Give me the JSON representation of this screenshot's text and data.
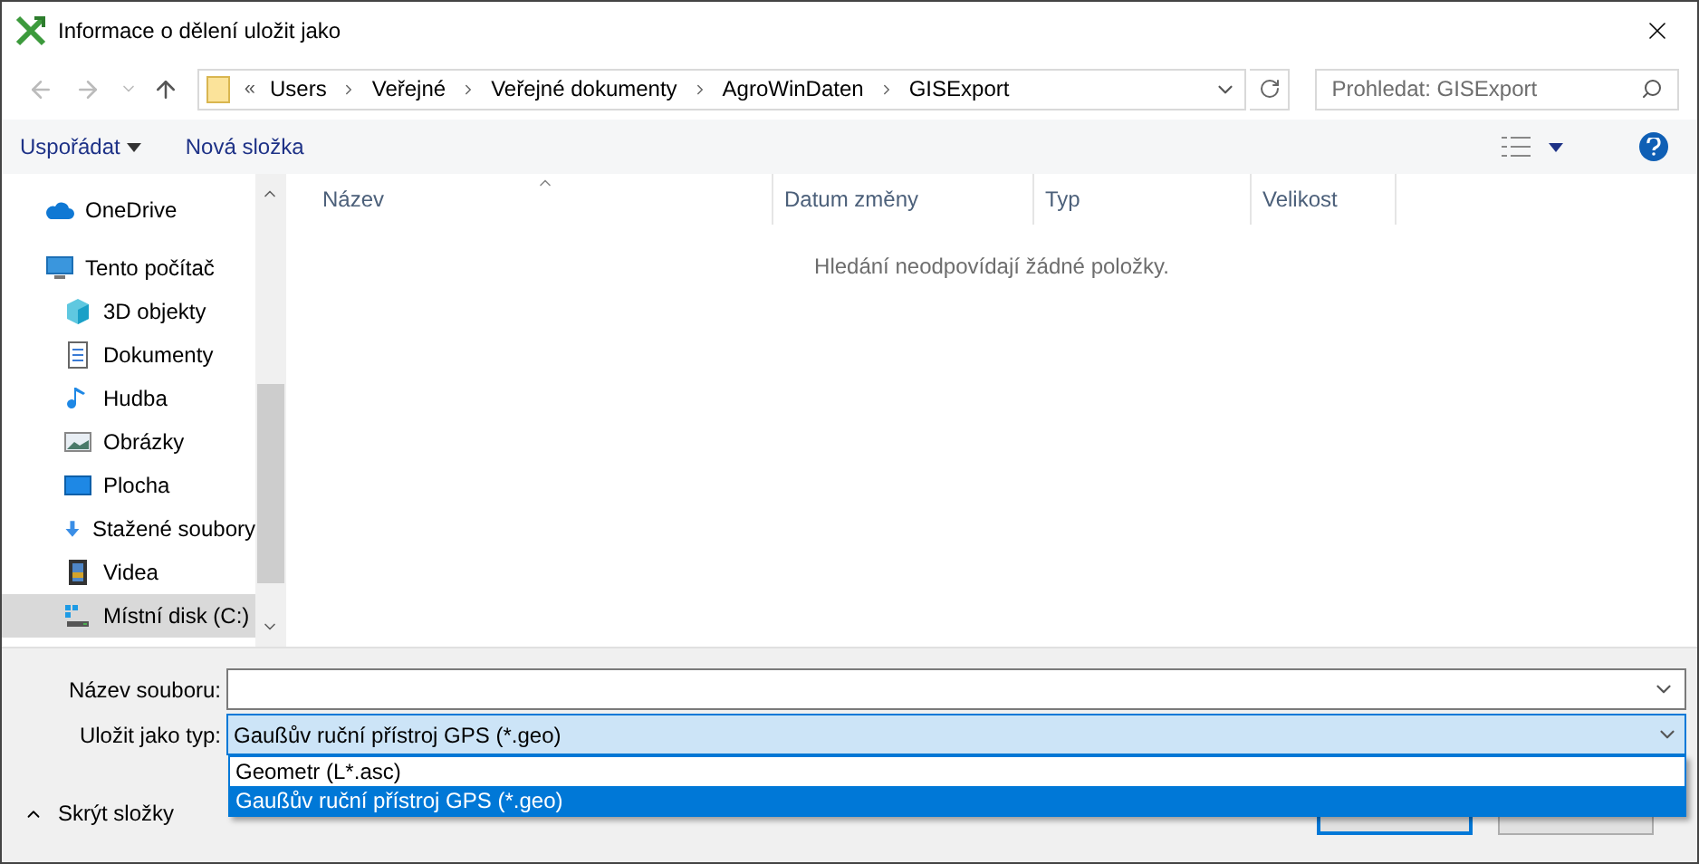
{
  "window": {
    "title": "Informace o dělení uložit jako"
  },
  "breadcrumb": {
    "overflow": "«",
    "segments": [
      "Users",
      "Veřejné",
      "Veřejné dokumenty",
      "AgroWinDaten",
      "GISExport"
    ]
  },
  "search": {
    "placeholder": "Prohledat: GISExport"
  },
  "toolbar": {
    "organize": "Uspořádat",
    "new_folder": "Nová složka"
  },
  "sidebar": {
    "items": [
      {
        "label": "OneDrive",
        "selected": false
      },
      {
        "label": "Tento počítač",
        "selected": false,
        "children": [
          {
            "label": "3D objekty",
            "selected": false
          },
          {
            "label": "Dokumenty",
            "selected": false
          },
          {
            "label": "Hudba",
            "selected": false
          },
          {
            "label": "Obrázky",
            "selected": false
          },
          {
            "label": "Plocha",
            "selected": false
          },
          {
            "label": "Stažené soubory",
            "selected": false
          },
          {
            "label": "Videa",
            "selected": false
          },
          {
            "label": "Místní disk (C:)",
            "selected": true
          }
        ]
      }
    ]
  },
  "table": {
    "columns": [
      "Název",
      "Datum změny",
      "Typ",
      "Velikost"
    ],
    "empty_message": "Hledání neodpovídají žádné položky."
  },
  "form": {
    "filename_label": "Název souboru:",
    "type_label": "Uložit jako typ:",
    "type_value": "Gaußův ruční přístroj GPS (*.geo)",
    "type_options": [
      {
        "label": "Geometr (L*.asc)",
        "selected": false
      },
      {
        "label": "Gaußův ruční přístroj GPS (*.geo)",
        "selected": true
      }
    ]
  },
  "hide_folders": "Skrýt složky",
  "buttons": [
    {
      "default": true
    },
    {
      "default": false
    }
  ]
}
